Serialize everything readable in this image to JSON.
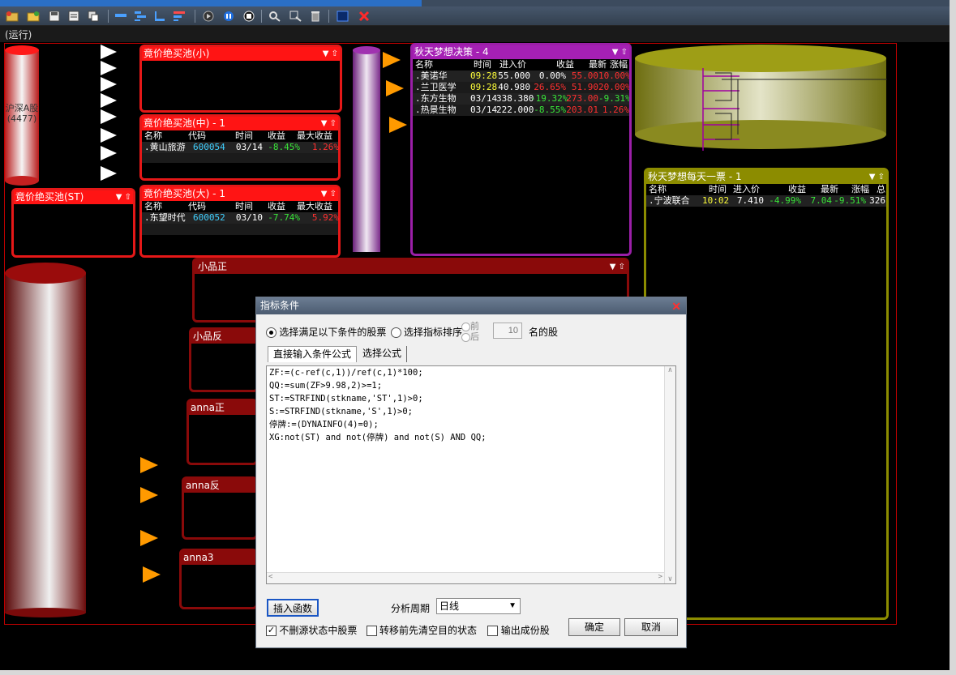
{
  "toolbar": {
    "icons": [
      "add-pool-icon",
      "open-folder-icon",
      "save-icon",
      "save-as-icon",
      "copy-window-icon",
      "align-top-icon",
      "align-vertical-icon",
      "align-left-icon",
      "align-horizontal-icon",
      "play-icon",
      "pause-icon",
      "stop-icon",
      "zoom-fit-icon",
      "zoom-select-icon",
      "trash-icon",
      "select-frame-icon",
      "close-x-icon"
    ]
  },
  "status": {
    "label": "(运行)"
  },
  "cylinders": {
    "left_label": "沪深A股",
    "left_count": "(4477)"
  },
  "pool_small": {
    "title": "竟价绝买池(小)"
  },
  "pool_mid": {
    "title": "竟价绝买池(中) - 1",
    "columns": [
      "名称",
      "代码",
      "时间",
      "收益",
      "最大收益"
    ],
    "rows": [
      {
        "name": ".黄山旅游",
        "code": "600054",
        "time": "03/14",
        "gain": "-8.45%",
        "max": "1.26%"
      }
    ]
  },
  "pool_st": {
    "title": "竟价绝买池(ST)"
  },
  "pool_big": {
    "title": "竟价绝买池(大) - 1",
    "columns": [
      "名称",
      "代码",
      "时间",
      "收益",
      "最大收益"
    ],
    "rows": [
      {
        "name": ".东望时代",
        "code": "600052",
        "time": "03/10",
        "gain": "-7.74%",
        "max": "5.92%"
      }
    ]
  },
  "decision": {
    "title": "秋天梦想决策 - 4",
    "columns": [
      "名称",
      "时间",
      "进入价",
      "收益",
      "最新",
      "涨幅"
    ],
    "rows": [
      {
        "name": ".美诺华",
        "time": "09:28",
        "price": "55.000",
        "gain": "0.00%",
        "last": "55.00",
        "pct": "10.00%"
      },
      {
        "name": ".兰卫医学",
        "time": "09:28",
        "price": "40.980",
        "gain": "26.65%",
        "last": "51.90",
        "pct": "20.00%"
      },
      {
        "name": ".东方生物",
        "time": "03/14",
        "price": "338.380",
        "gain": "-19.32%",
        "last": "273.00",
        "pct": "-9.31%"
      },
      {
        "name": ".热景生物",
        "time": "03/14",
        "price": "222.000",
        "gain": "-8.55%",
        "last": "203.01",
        "pct": "1.26%"
      }
    ]
  },
  "daily": {
    "title": "秋天梦想每天一票 - 1",
    "columns": [
      "名称",
      "时间",
      "进入价",
      "收益",
      "最新",
      "涨幅",
      "总"
    ],
    "rows": [
      {
        "name": ".宁波联合",
        "time": "10:02",
        "price": "7.410",
        "gain": "-4.99%",
        "last": "7.04",
        "pct": "-9.51%",
        "extra": "326"
      }
    ]
  },
  "dark_pools": {
    "xpz": "小品正",
    "xpf": "小品反",
    "annaz": "anna正",
    "annaf": "anna反",
    "anna3": "anna3"
  },
  "dialog": {
    "title": "指标条件",
    "radio_select_cond": "选择满足以下条件的股票",
    "radio_select_rank": "选择指标排序",
    "front": "前",
    "back": "后",
    "count_value": "10",
    "count_suffix": "名的股",
    "tab_direct": "直接输入条件公式",
    "tab_choose": "选择公式",
    "formula_lines": [
      "ZF:=(c-ref(c,1))/ref(c,1)*100;",
      "QQ:=sum(ZF>9.98,2)>=1;",
      "ST:=STRFIND(stkname,'ST',1)>0;",
      "S:=STRFIND(stkname,'S',1)>0;",
      "停牌:=(DYNAINFO(4)=0);",
      "XG:not(ST) and not(停牌) and not(S) AND QQ;"
    ],
    "insert_func": "插入函数",
    "period_label": "分析周期",
    "period_value": "日线",
    "chk_no_delete": "不删源状态中股票",
    "chk_clear_target": "转移前先清空目的状态",
    "chk_output": "输出成份股",
    "ok": "确定",
    "cancel": "取消"
  },
  "colors": {
    "pool_red": "#ff1414",
    "decision_purple": "#9b1fa8",
    "daily_olive": "#8c8c00",
    "gain_green": "#39e639",
    "loss_red": "#ff3030"
  }
}
